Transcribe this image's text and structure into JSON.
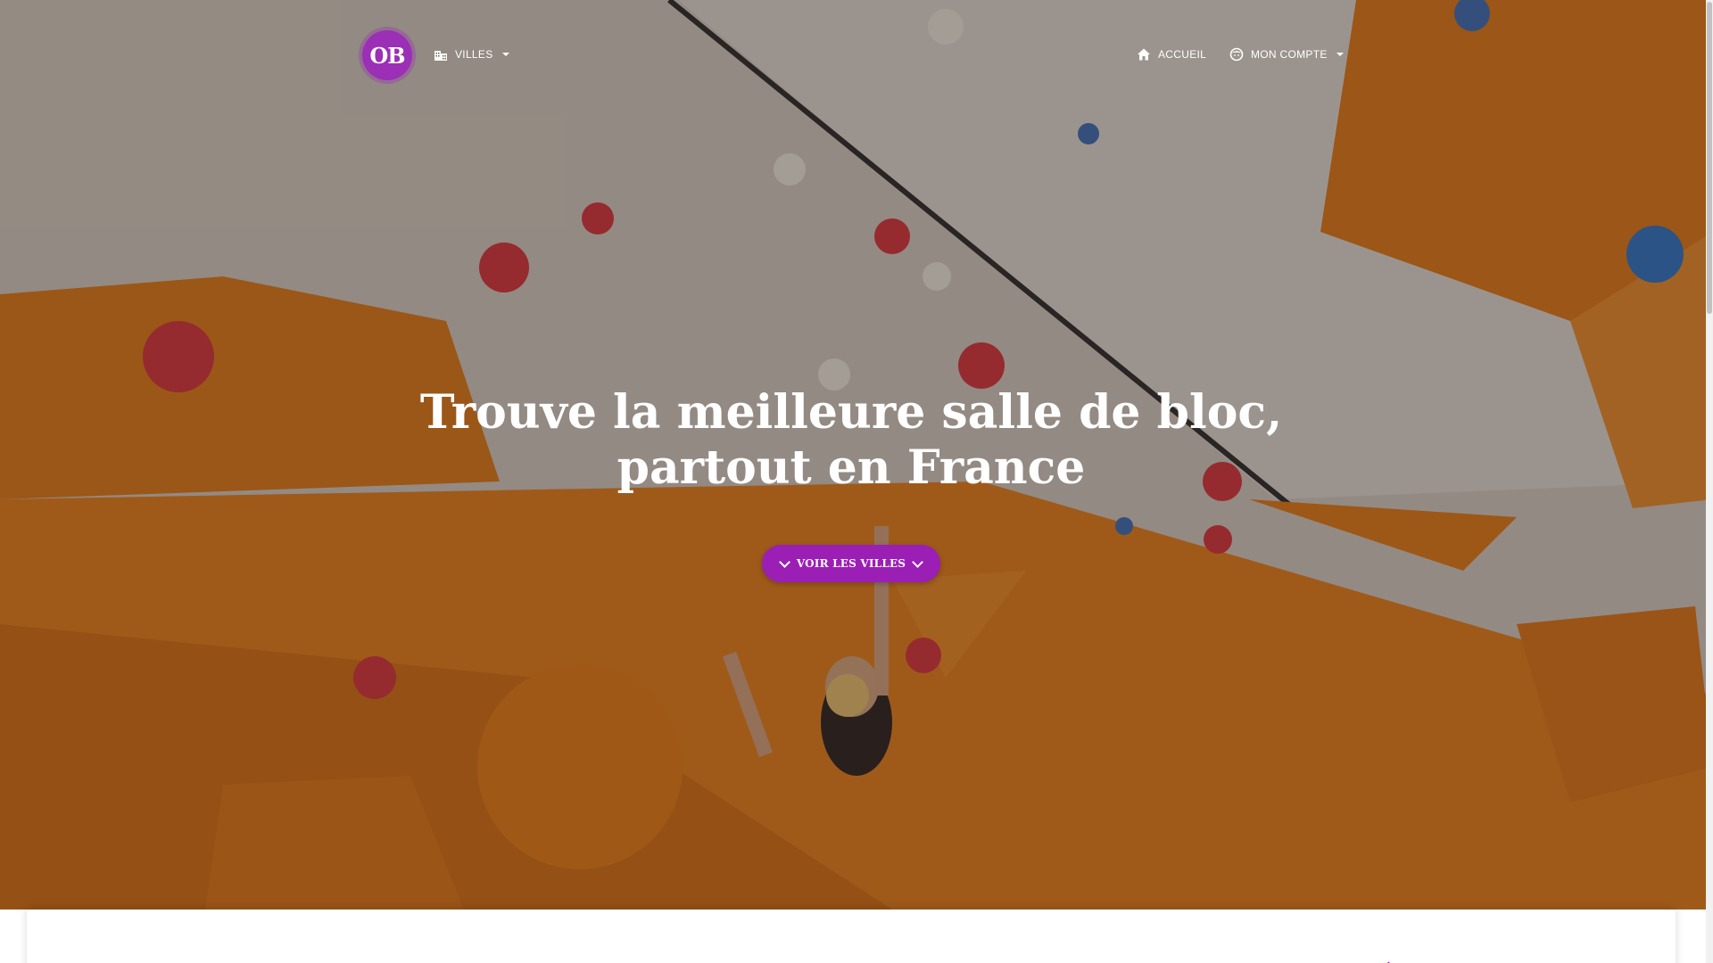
{
  "logo": {
    "text": "OB"
  },
  "nav": {
    "villes_label": "VILLES",
    "accueil_label": "ACCUEIL",
    "compte_label": "MON COMPTE"
  },
  "hero": {
    "title_line1": "Trouve la meilleure salle de bloc,",
    "title_line2": "partout en France",
    "cta_label": "VOIR LES VILLES"
  },
  "colors": {
    "brand_purple": "#9b1fb5",
    "wall_orange": "#e07a14",
    "wall_beige": "#cfc6bb"
  },
  "icons": {
    "villes": "city-buildings-icon",
    "accueil": "home-icon",
    "compte": "user-face-icon",
    "cta": "chevron-down-icon"
  }
}
